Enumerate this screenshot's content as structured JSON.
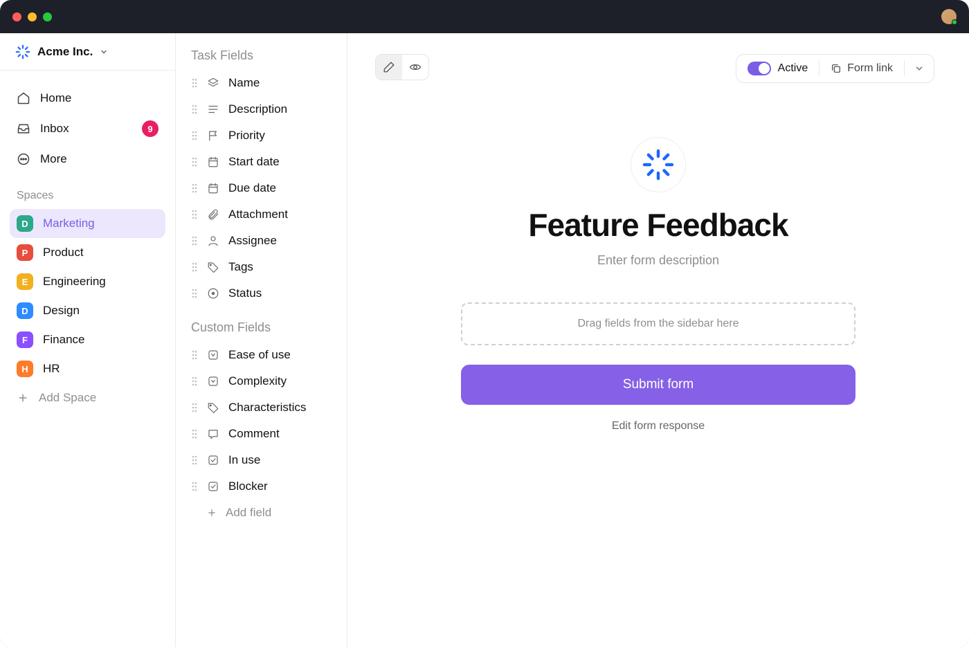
{
  "workspace": {
    "name": "Acme Inc."
  },
  "nav": {
    "home": "Home",
    "inbox": "Inbox",
    "inbox_badge": "9",
    "more": "More"
  },
  "spaces": {
    "title": "Spaces",
    "items": [
      {
        "letter": "D",
        "label": "Marketing",
        "color": "#2ea88a",
        "active": true
      },
      {
        "letter": "P",
        "label": "Product",
        "color": "#e74c3c",
        "active": false
      },
      {
        "letter": "E",
        "label": "Engineering",
        "color": "#f2b01e",
        "active": false
      },
      {
        "letter": "D",
        "label": "Design",
        "color": "#2d8cff",
        "active": false
      },
      {
        "letter": "F",
        "label": "Finance",
        "color": "#8a4fff",
        "active": false
      },
      {
        "letter": "H",
        "label": "HR",
        "color": "#ff7a29",
        "active": false
      }
    ],
    "add": "Add Space"
  },
  "fields": {
    "task_title": "Task Fields",
    "task_items": [
      {
        "icon": "layers",
        "label": "Name"
      },
      {
        "icon": "description",
        "label": "Description"
      },
      {
        "icon": "flag",
        "label": "Priority"
      },
      {
        "icon": "calendar",
        "label": "Start date"
      },
      {
        "icon": "calendar",
        "label": "Due date"
      },
      {
        "icon": "attachment",
        "label": "Attachment"
      },
      {
        "icon": "person",
        "label": "Assignee"
      },
      {
        "icon": "tag",
        "label": "Tags"
      },
      {
        "icon": "status",
        "label": "Status"
      }
    ],
    "custom_title": "Custom Fields",
    "custom_items": [
      {
        "icon": "dropdown",
        "label": "Ease of use"
      },
      {
        "icon": "dropdown",
        "label": "Complexity"
      },
      {
        "icon": "tag",
        "label": "Characteristics"
      },
      {
        "icon": "comment",
        "label": "Comment"
      },
      {
        "icon": "checkbox",
        "label": "In use"
      },
      {
        "icon": "checkbox",
        "label": "Blocker"
      }
    ],
    "add": "Add field"
  },
  "toolbar": {
    "active_label": "Active",
    "form_link_label": "Form link"
  },
  "form": {
    "title": "Feature Feedback",
    "description_placeholder": "Enter form description",
    "drop_hint": "Drag fields from the sidebar here",
    "submit_label": "Submit form",
    "edit_response_label": "Edit form response"
  }
}
